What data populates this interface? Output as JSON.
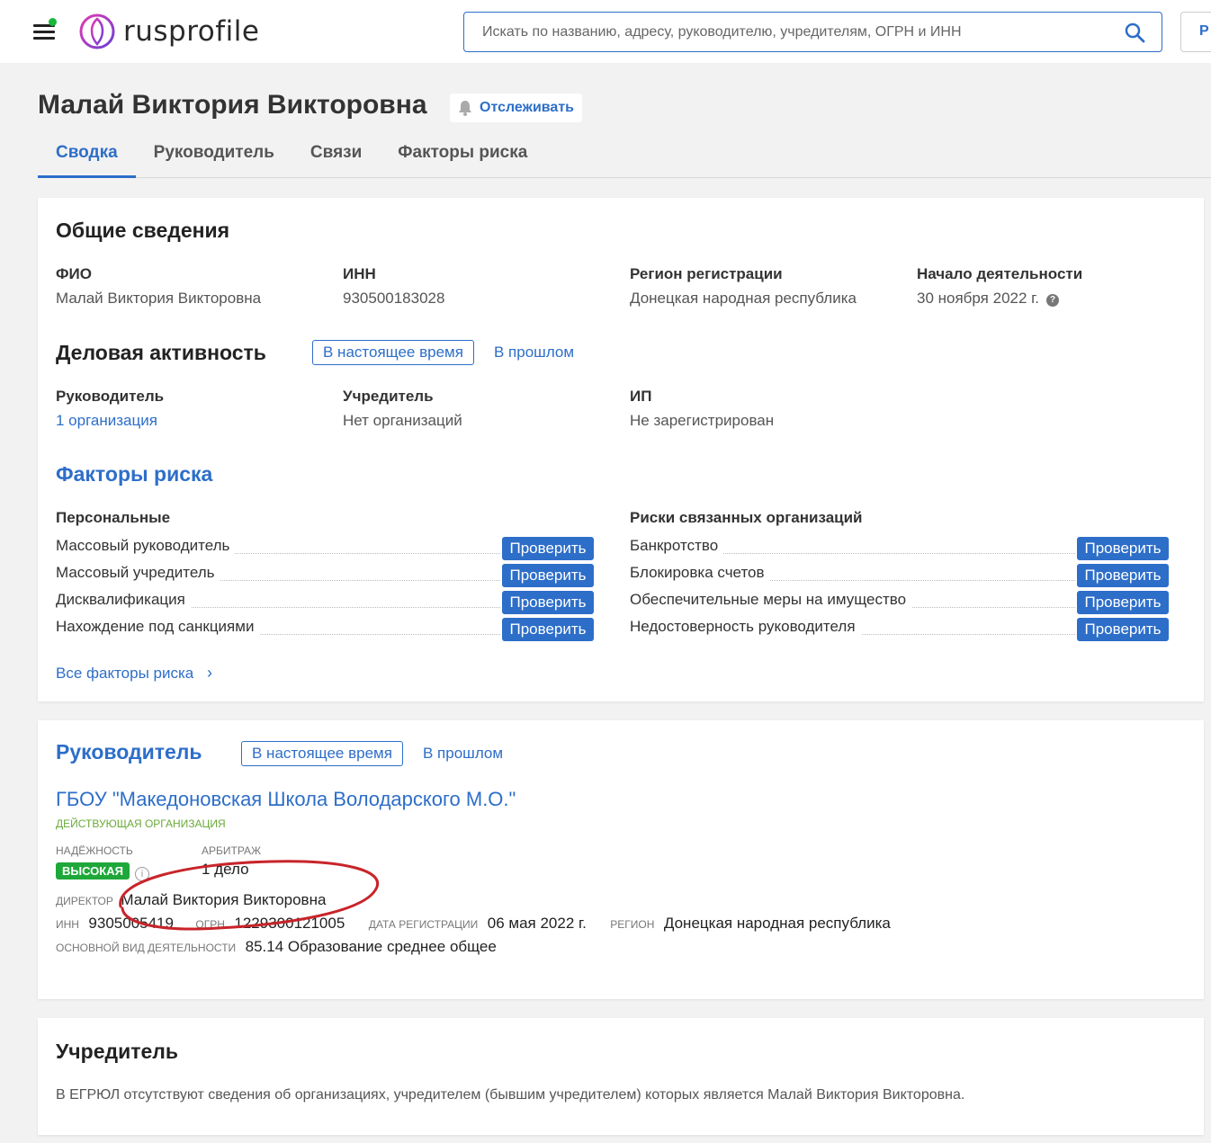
{
  "header": {
    "logo_text": "rusprofile",
    "search_placeholder": "Искать по названию, адресу, руководителю, учредителям, ОГРН и ИНН",
    "login_stub": "Р"
  },
  "person": {
    "name": "Малай Виктория Викторовна",
    "follow_label": "Отслеживать"
  },
  "tabs": [
    {
      "label": "Сводка",
      "active": true
    },
    {
      "label": "Руководитель",
      "active": false
    },
    {
      "label": "Связи",
      "active": false
    },
    {
      "label": "Факторы риска",
      "active": false
    }
  ],
  "general": {
    "title": "Общие сведения",
    "fio_label": "ФИО",
    "fio_value": "Малай Виктория Викторовна",
    "inn_label": "ИНН",
    "inn_value": "930500183028",
    "region_label": "Регион регистрации",
    "region_value": "Донецкая народная республика",
    "start_label": "Начало деятельности",
    "start_value": "30 ноября 2022 г."
  },
  "activity": {
    "title": "Деловая активность",
    "now_label": "В настоящее время",
    "past_label": "В прошлом",
    "head_label": "Руководитель",
    "head_value": "1 организация",
    "founder_label": "Учредитель",
    "founder_value": "Нет организаций",
    "ip_label": "ИП",
    "ip_value": "Не зарегистрирован"
  },
  "risks": {
    "title": "Факторы риска",
    "personal_title": "Персональные",
    "personal": [
      "Массовый руководитель",
      "Массовый учредитель",
      "Дисквалификация",
      "Нахождение под санкциями"
    ],
    "related_title": "Риски связанных организаций",
    "related": [
      "Банкротство",
      "Блокировка счетов",
      "Обеспечительные меры на имущество",
      "Недостоверность руководителя"
    ],
    "check_label": "Проверить",
    "all_link": "Все факторы риска",
    "chevron": "›"
  },
  "head_section": {
    "title": "Руководитель",
    "now_label": "В настоящее время",
    "past_label": "В прошлом",
    "org_name": "ГБОУ \"Македоновская Школа Володарского М.О.\"",
    "org_status": "действующая организация",
    "reliability_label": "Надёжность",
    "reliability_value": "ВЫСОКАЯ",
    "arbitration_label": "Арбитраж",
    "arbitration_value": "1 дело",
    "director_label": "Директор",
    "director_value": "Малай Виктория Викторовна",
    "inn_label": "ИНН",
    "inn_value": "9305005419",
    "ogrn_label": "ОГРН",
    "ogrn_value": "1229300121005",
    "regdate_label": "Дата регистрации",
    "regdate_value": "06 мая 2022 г.",
    "region_label": "Регион",
    "region_value": "Донецкая народная республика",
    "okved_label": "Основной вид деятельности",
    "okved_value": "85.14 Образование среднее общее"
  },
  "founder_section": {
    "title": "Учредитель",
    "text": "В ЕГРЮЛ отсутствуют сведения об организациях, учредителем (бывшим учредителем) которых является Малай Виктория Викторовна."
  },
  "colors": {
    "accent": "#2d6ec9",
    "green_badge": "#1fa83a",
    "annotation_red": "#c8242a"
  }
}
